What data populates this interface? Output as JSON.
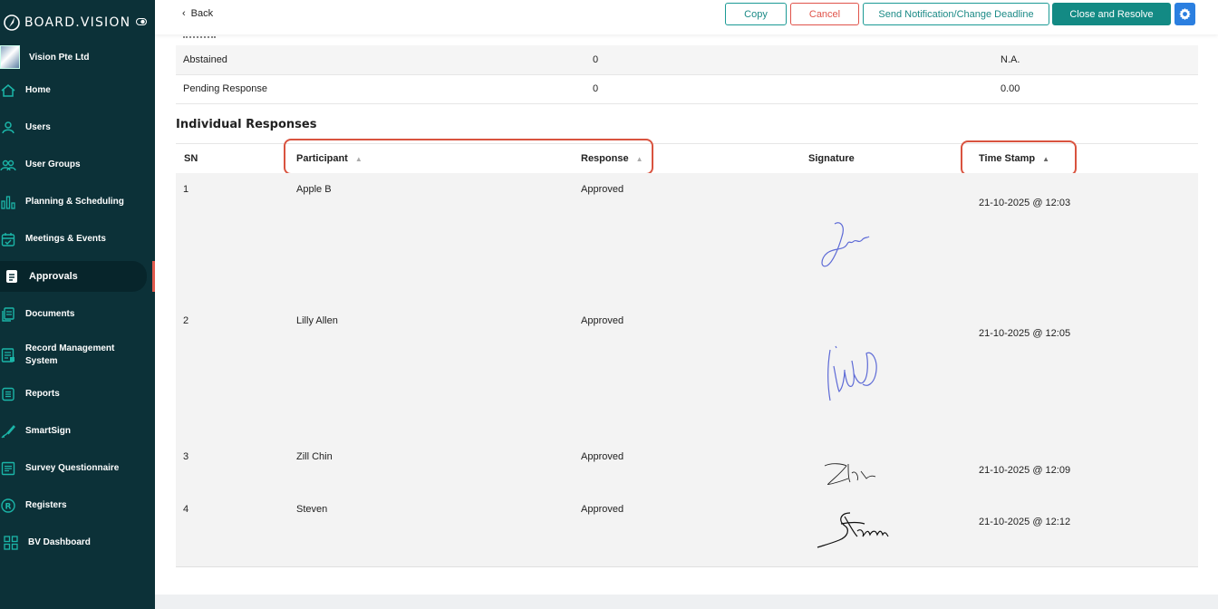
{
  "app": {
    "logo_text": "BOARD.VISION"
  },
  "sidebar": {
    "org_name": "Vision Pte Ltd",
    "items": [
      {
        "label": "Home",
        "icon": "home-icon"
      },
      {
        "label": "Users",
        "icon": "user-icon"
      },
      {
        "label": "User Groups",
        "icon": "user-group-icon"
      },
      {
        "label": "Planning & Scheduling",
        "icon": "bar-chart-icon"
      },
      {
        "label": "Meetings & Events",
        "icon": "calendar-icon"
      },
      {
        "label": "Approvals",
        "icon": "approvals-icon",
        "active": true
      },
      {
        "label": "Documents",
        "icon": "documents-icon"
      },
      {
        "label": "Record Management System",
        "icon": "record-icon"
      },
      {
        "label": "Reports",
        "icon": "reports-icon"
      },
      {
        "label": "SmartSign",
        "icon": "smartsign-icon"
      },
      {
        "label": "Survey Questionnaire",
        "icon": "survey-icon"
      },
      {
        "label": "Registers",
        "icon": "registers-icon"
      },
      {
        "label": "BV Dashboard",
        "icon": "dashboard-icon"
      }
    ]
  },
  "toolbar": {
    "back_label": "Back",
    "copy_label": "Copy",
    "cancel_label": "Cancel",
    "notify_label": "Send Notification/Change Deadline",
    "close_label": "Close and Resolve",
    "settings_icon": "gear-icon"
  },
  "summary": {
    "rows": [
      {
        "label": "Abstained",
        "count": "0",
        "value": "N.A."
      },
      {
        "label": "Pending Response",
        "count": "0",
        "value": "0.00"
      }
    ]
  },
  "responses": {
    "title": "Individual Responses",
    "columns": {
      "sn": "SN",
      "participant": "Participant",
      "response": "Response",
      "signature": "Signature",
      "timestamp": "Time Stamp"
    },
    "rows": [
      {
        "sn": "1",
        "participant": "Apple B",
        "response": "Approved",
        "timestamp": "21-10-2025 @ 12:03"
      },
      {
        "sn": "2",
        "participant": "Lilly Allen",
        "response": "Approved",
        "timestamp": "21-10-2025 @ 12:05"
      },
      {
        "sn": "3",
        "participant": "Zill Chin",
        "response": "Approved",
        "timestamp": "21-10-2025 @ 12:09"
      },
      {
        "sn": "4",
        "participant": "Steven",
        "response": "Approved",
        "timestamp": "21-10-2025 @ 12:12"
      }
    ]
  },
  "colors": {
    "sidebar_bg": "#0c3138",
    "accent_teal": "#138a84",
    "cancel_red": "#e0534a",
    "highlight_red": "#d9533f",
    "settings_blue": "#2b7fe0"
  }
}
